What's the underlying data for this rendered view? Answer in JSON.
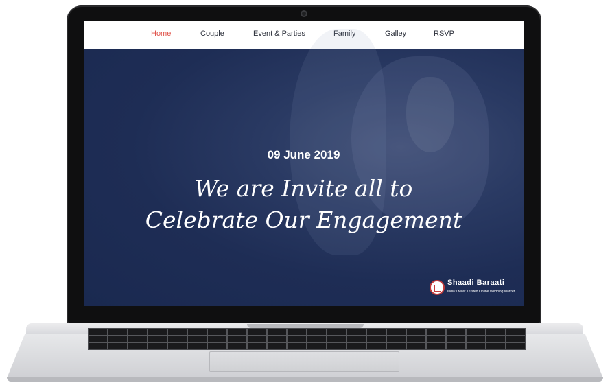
{
  "nav": {
    "items": [
      {
        "label": "Home",
        "active": true
      },
      {
        "label": "Couple",
        "active": false
      },
      {
        "label": "Event & Parties",
        "active": false
      },
      {
        "label": "Family",
        "active": false
      },
      {
        "label": "Galley",
        "active": false
      },
      {
        "label": "RSVP",
        "active": false
      }
    ],
    "active_color": "#e0534a"
  },
  "hero": {
    "date": "09 June 2019",
    "headline_line1": "We are Invite all to",
    "headline_line2": "Celebrate Our Engagement",
    "overlay_color": "#1e2d55"
  },
  "brand": {
    "name": "Shaadi Baraati",
    "tagline": "India's Most Trusted Online Wedding Market",
    "logo_icon": "mandap-logo-icon"
  }
}
